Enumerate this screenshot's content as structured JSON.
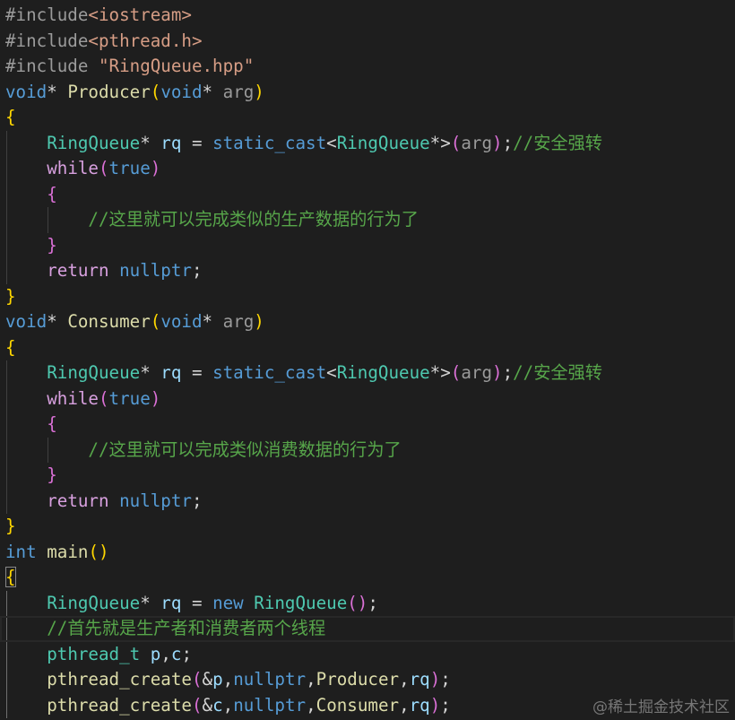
{
  "editor": {
    "colors": {
      "background": "#1e1e1e",
      "pp": "#9b9b9b",
      "str": "#d69d85",
      "kw": "#569cd6",
      "ctrl": "#d8a0df",
      "type": "#4ec9b0",
      "fn": "#dcdcaa",
      "var": "#9cdcfe",
      "param": "#9a9a9a",
      "op": "#d4d4d4",
      "comment": "#57a64a",
      "br1": "#ffd700",
      "br2": "#da70d6",
      "guide": "#404040",
      "guide_active": "#707070",
      "line_highlight_border": "#282828",
      "bracket_match_border": "#888888"
    },
    "current_line": 25,
    "lines": [
      [
        [
          "#include",
          "pp"
        ],
        [
          "<iostream>",
          "str"
        ]
      ],
      [
        [
          "#include",
          "pp"
        ],
        [
          "<pthread.h>",
          "str"
        ]
      ],
      [
        [
          "#include",
          "pp"
        ],
        [
          " ",
          "op"
        ],
        [
          "\"RingQueue.hpp\"",
          "str"
        ]
      ],
      [
        [
          "void",
          "kw"
        ],
        [
          "* ",
          "op"
        ],
        [
          "Producer",
          "fn"
        ],
        [
          "(",
          "br1"
        ],
        [
          "void",
          "kw"
        ],
        [
          "* ",
          "op"
        ],
        [
          "arg",
          "param"
        ],
        [
          ")",
          "br1"
        ]
      ],
      [
        [
          "{",
          "br1"
        ]
      ],
      [
        [
          "    ",
          "ws"
        ],
        [
          "RingQueue",
          "type"
        ],
        [
          "* ",
          "op"
        ],
        [
          "rq",
          "var"
        ],
        [
          " = ",
          "op"
        ],
        [
          "static_cast",
          "kw"
        ],
        [
          "<",
          "op"
        ],
        [
          "RingQueue",
          "type"
        ],
        [
          "*>",
          "op"
        ],
        [
          "(",
          "br2"
        ],
        [
          "arg",
          "param"
        ],
        [
          ")",
          "br2"
        ],
        [
          ";",
          "op"
        ],
        [
          "//安全强转",
          "comment"
        ]
      ],
      [
        [
          "    ",
          "ws"
        ],
        [
          "while",
          "ctrl"
        ],
        [
          "(",
          "br2"
        ],
        [
          "true",
          "kw"
        ],
        [
          ")",
          "br2"
        ]
      ],
      [
        [
          "    ",
          "ws"
        ],
        [
          "{",
          "br2"
        ]
      ],
      [
        [
          "        ",
          "ws"
        ],
        [
          "//这里就可以完成类似的生产数据的行为了",
          "comment"
        ]
      ],
      [
        [
          "    ",
          "ws"
        ],
        [
          "}",
          "br2"
        ]
      ],
      [
        [
          "    ",
          "ws"
        ],
        [
          "return",
          "ctrl"
        ],
        [
          " ",
          "op"
        ],
        [
          "nullptr",
          "kw"
        ],
        [
          ";",
          "op"
        ]
      ],
      [
        [
          "}",
          "br1"
        ]
      ],
      [
        [
          "void",
          "kw"
        ],
        [
          "* ",
          "op"
        ],
        [
          "Consumer",
          "fn"
        ],
        [
          "(",
          "br1"
        ],
        [
          "void",
          "kw"
        ],
        [
          "* ",
          "op"
        ],
        [
          "arg",
          "param"
        ],
        [
          ")",
          "br1"
        ]
      ],
      [
        [
          "{",
          "br1"
        ]
      ],
      [
        [
          "    ",
          "ws"
        ],
        [
          "RingQueue",
          "type"
        ],
        [
          "* ",
          "op"
        ],
        [
          "rq",
          "var"
        ],
        [
          " = ",
          "op"
        ],
        [
          "static_cast",
          "kw"
        ],
        [
          "<",
          "op"
        ],
        [
          "RingQueue",
          "type"
        ],
        [
          "*>",
          "op"
        ],
        [
          "(",
          "br2"
        ],
        [
          "arg",
          "param"
        ],
        [
          ")",
          "br2"
        ],
        [
          ";",
          "op"
        ],
        [
          "//安全强转",
          "comment"
        ]
      ],
      [
        [
          "    ",
          "ws"
        ],
        [
          "while",
          "ctrl"
        ],
        [
          "(",
          "br2"
        ],
        [
          "true",
          "kw"
        ],
        [
          ")",
          "br2"
        ]
      ],
      [
        [
          "    ",
          "ws"
        ],
        [
          "{",
          "br2"
        ]
      ],
      [
        [
          "        ",
          "ws"
        ],
        [
          "//这里就可以完成类似消费数据的行为了",
          "comment"
        ]
      ],
      [
        [
          "    ",
          "ws"
        ],
        [
          "}",
          "br2"
        ]
      ],
      [
        [
          "    ",
          "ws"
        ],
        [
          "return",
          "ctrl"
        ],
        [
          " ",
          "op"
        ],
        [
          "nullptr",
          "kw"
        ],
        [
          ";",
          "op"
        ]
      ],
      [
        [
          "}",
          "br1"
        ]
      ],
      [
        [
          "int",
          "kw"
        ],
        [
          " ",
          "op"
        ],
        [
          "main",
          "fn"
        ],
        [
          "()",
          "br1"
        ]
      ],
      [
        [
          "{",
          "br1",
          "matched"
        ]
      ],
      [
        [
          "    ",
          "ws"
        ],
        [
          "RingQueue",
          "type"
        ],
        [
          "* ",
          "op"
        ],
        [
          "rq",
          "var"
        ],
        [
          " = ",
          "op"
        ],
        [
          "new",
          "kw"
        ],
        [
          " ",
          "op"
        ],
        [
          "RingQueue",
          "type"
        ],
        [
          "()",
          "br2"
        ],
        [
          ";",
          "op"
        ]
      ],
      [
        [
          "    ",
          "ws"
        ],
        [
          "//首先就是生产者和消费者两个线程",
          "comment"
        ]
      ],
      [
        [
          "    ",
          "ws"
        ],
        [
          "pthread_t",
          "type"
        ],
        [
          " ",
          "op"
        ],
        [
          "p",
          "var"
        ],
        [
          ",",
          "op"
        ],
        [
          "c",
          "var"
        ],
        [
          ";",
          "op"
        ]
      ],
      [
        [
          "    ",
          "ws"
        ],
        [
          "pthread_create",
          "fn"
        ],
        [
          "(",
          "br2"
        ],
        [
          "&",
          "op"
        ],
        [
          "p",
          "var"
        ],
        [
          ",",
          "op"
        ],
        [
          "nullptr",
          "kw"
        ],
        [
          ",",
          "op"
        ],
        [
          "Producer",
          "fn"
        ],
        [
          ",",
          "op"
        ],
        [
          "rq",
          "var"
        ],
        [
          ")",
          "br2"
        ],
        [
          ";",
          "op"
        ]
      ],
      [
        [
          "    ",
          "ws"
        ],
        [
          "pthread_create",
          "fn"
        ],
        [
          "(",
          "br2"
        ],
        [
          "&",
          "op"
        ],
        [
          "c",
          "var"
        ],
        [
          ",",
          "op"
        ],
        [
          "nullptr",
          "kw"
        ],
        [
          ",",
          "op"
        ],
        [
          "Consumer",
          "fn"
        ],
        [
          ",",
          "op"
        ],
        [
          "rq",
          "var"
        ],
        [
          ")",
          "br2"
        ],
        [
          ";",
          "op"
        ]
      ]
    ]
  },
  "watermark": "@稀土掘金技术社区"
}
